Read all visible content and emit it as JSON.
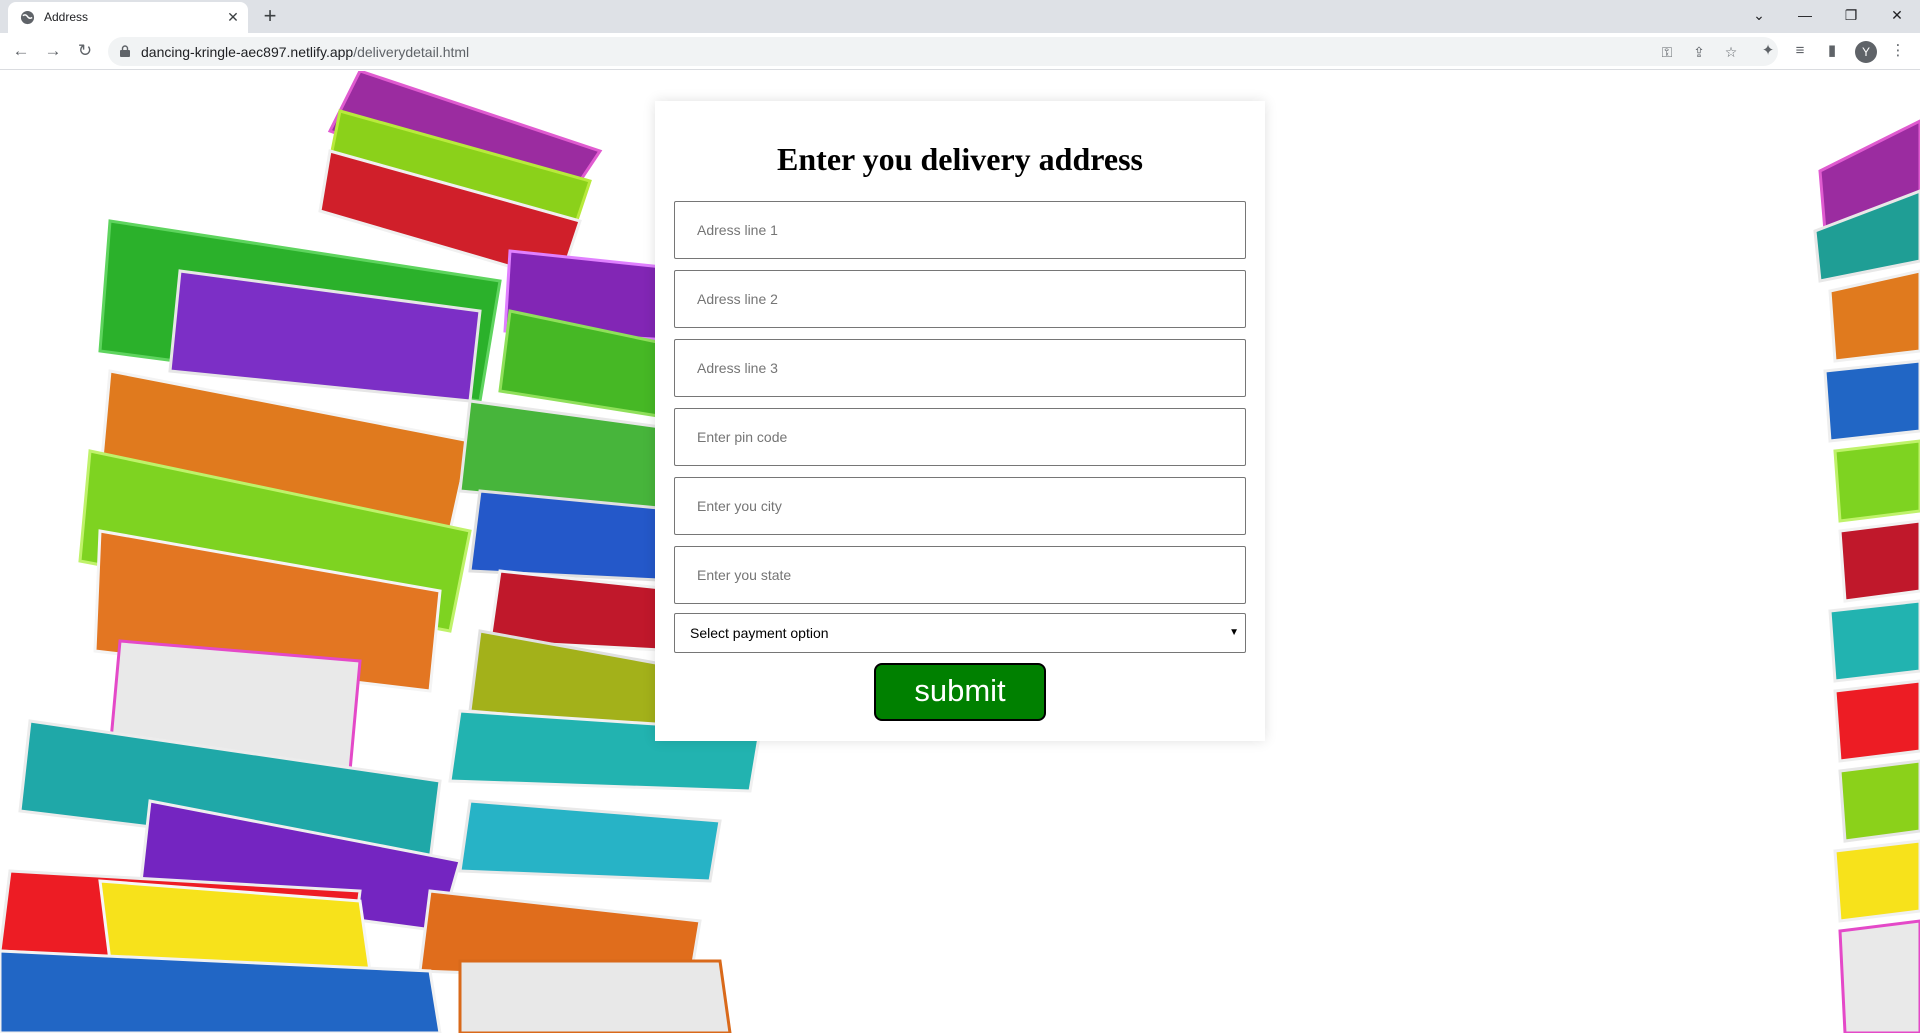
{
  "browser": {
    "tab_title": "Address",
    "url_domain": "dancing-kringle-aec897.netlify.app",
    "url_path": "/deliverydetail.html",
    "profile_initial": "Y"
  },
  "form": {
    "heading": "Enter you delivery address",
    "fields": [
      {
        "placeholder": "Adress line 1"
      },
      {
        "placeholder": "Adress line 2"
      },
      {
        "placeholder": "Adress line 3"
      },
      {
        "placeholder": "Enter pin code"
      },
      {
        "placeholder": "Enter you city"
      },
      {
        "placeholder": "Enter you state"
      }
    ],
    "payment_select": {
      "selected": "Select payment option"
    },
    "submit_label": "submit",
    "submit_color": "#008000"
  }
}
